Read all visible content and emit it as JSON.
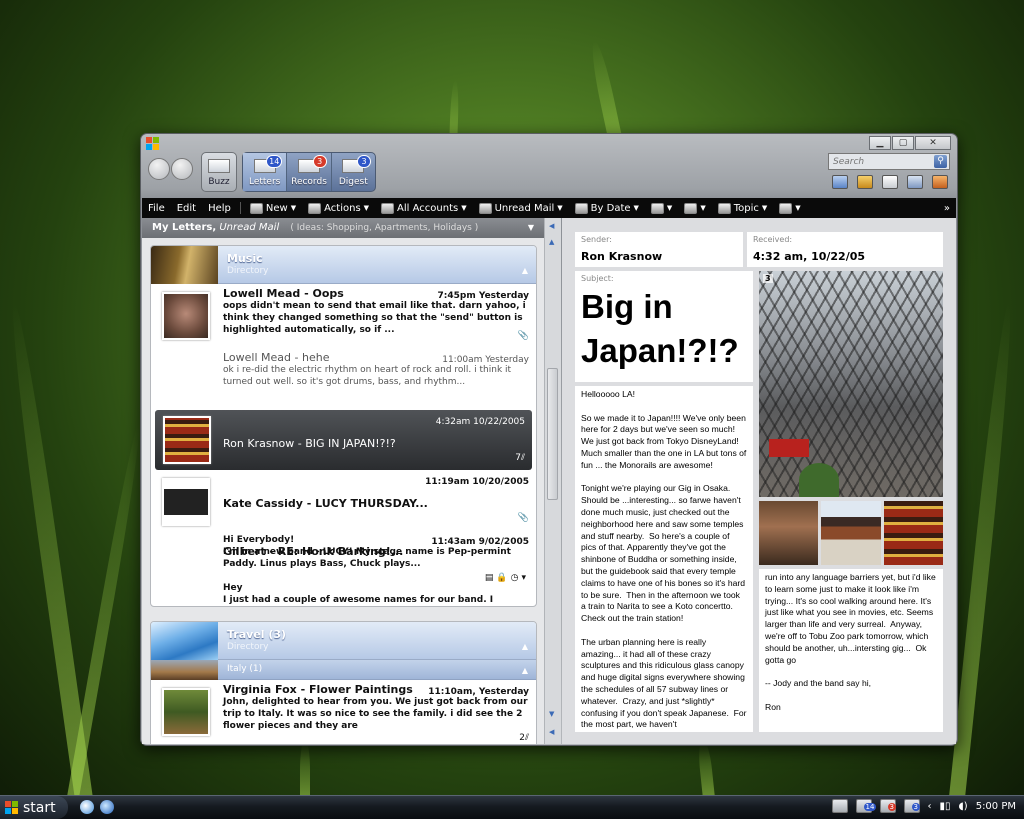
{
  "window": {
    "controls": {
      "minimize": "▁",
      "maximize": "▢",
      "close": "✕"
    }
  },
  "views": [
    {
      "label": "Buzz",
      "badge": ""
    },
    {
      "label": "Letters",
      "badge": "14",
      "badge_color": "#2f57c9"
    },
    {
      "label": "Records",
      "badge": "3",
      "badge_color": "#d63a2a"
    },
    {
      "label": "Digest",
      "badge": "3",
      "badge_color": "#2f57c9"
    }
  ],
  "search": {
    "placeholder": "Search"
  },
  "menu": {
    "file": "File",
    "edit": "Edit",
    "help": "Help",
    "new": "New",
    "actions": "Actions",
    "all_accounts": "All Accounts",
    "unread_mail": "Unread Mail",
    "by_date": "By Date",
    "topic": "Topic"
  },
  "list": {
    "title": "My Letters,",
    "filter": "Unread Mail",
    "hint": "( Ideas: Shopping, Apartments, Holidays )",
    "groups": [
      {
        "title": "Music",
        "subtitle": "Directory",
        "messages": [
          {
            "from": "Lowell Mead - Oops",
            "time": "7:45pm Yesterday",
            "body": "oops didn't mean to send that email like that.  darn yahoo, i think they changed something so that the \"send\" button is highlighted automatically, so if ...",
            "state": "unread"
          },
          {
            "from": "Lowell Mead - hehe",
            "time": "11:00am Yesterday",
            "body": "ok i re-did the electric rhythm on heart of rock and roll. i think it turned out well.  so it's got drums, bass, and rhythm...",
            "state": "read"
          },
          {
            "from": "Ron Krasnow - BIG IN JAPAN!?!?",
            "time": "4:32am 10/22/2005",
            "body": "Hellooooo LA!\nSe we made it to Japan!!!!  We've only been here for 2 days but we've seen so much!  We just got back from ...",
            "state": "selected",
            "attach": "7"
          },
          {
            "from": "Kate Cassidy - LUCY THURSDAY...",
            "time": "11:19am 10/20/2005",
            "body": "Hi Everybody!\nI'm in a new band - LUCY!  My stage name is Pep-permint Paddy.  Linus plays Bass, Chuck plays...",
            "state": "unread"
          },
          {
            "from": "Gilbert - RE: Honk Barking!...",
            "time": "11:43am 9/02/2005",
            "body": "Hey\nI just had a couple of awesome names for our band.  I thought they were cool anyhow... :)",
            "state": "unread"
          }
        ]
      },
      {
        "title": "Travel (3)",
        "subtitle": "Directory",
        "subgroup": "Italy (1)",
        "messages": [
          {
            "from": "Virginia Fox - Flower Paintings",
            "time": "11:10am, Yesterday",
            "body": "John, delighted to hear from you.  We just got back from our trip to Italy.  It was so nice to see the family.  i did see the 2 flower pieces and they are",
            "state": "unread",
            "attach": "2"
          }
        ]
      }
    ]
  },
  "reading": {
    "sender_label": "Sender:",
    "sender": "Ron Krasnow",
    "received_label": "Received:",
    "received": "4:32 am, 10/22/05",
    "subject_label": "Subject:",
    "subject": "Big in Japan!?!?",
    "photo_count": "3",
    "body_left": "Hellooooo LA!\n\nSo we made it to Japan!!!! We've only been here for 2 days but we've seen so much! We just got back from Tokyo DisneyLand! Much smaller than the one in LA but tons of fun ... the Monorails are awesome!\n\nTonight we're playing our Gig in Osaka. Should be ...interesting... so farwe haven't done much music, just checked out the neighborhood here and saw some temples and stuff nearby.  So here's a couple of pics of that. Apparently they've got the shinbone of Buddha or something inside, but the guidebook said that every temple claims to have one of his bones so it's hard to be sure.  Then in the afternoon we took a train to Narita to see a Koto concertto.  Check out the train station!\n\nThe urban planning here is really amazing... it had all of these crazy sculptures and this ridiculous glass canopy and huge digital signs everywhere showing the schedules of all 57 subway lines or whatever.  Crazy, and just *slightly* confusing if you don't speak Japanese.  For the most part, we haven't",
    "body_right": "run into any language barriers yet, but i'd like to learn some just to make it look like i'm trying... It's so cool walking around here. It's just like what you see in movies, etc. Seems larger than life and very surreal.  Anyway, we're off to Tobu Zoo park tomorrow, which should be another, uh...intersting gig...  Ok gotta go\n\n-- Jody and the band say hi,\n\nRon"
  },
  "taskbar": {
    "start": "start",
    "tray_badges": [
      "14",
      "3",
      "3"
    ],
    "clock": "5:00 PM"
  }
}
